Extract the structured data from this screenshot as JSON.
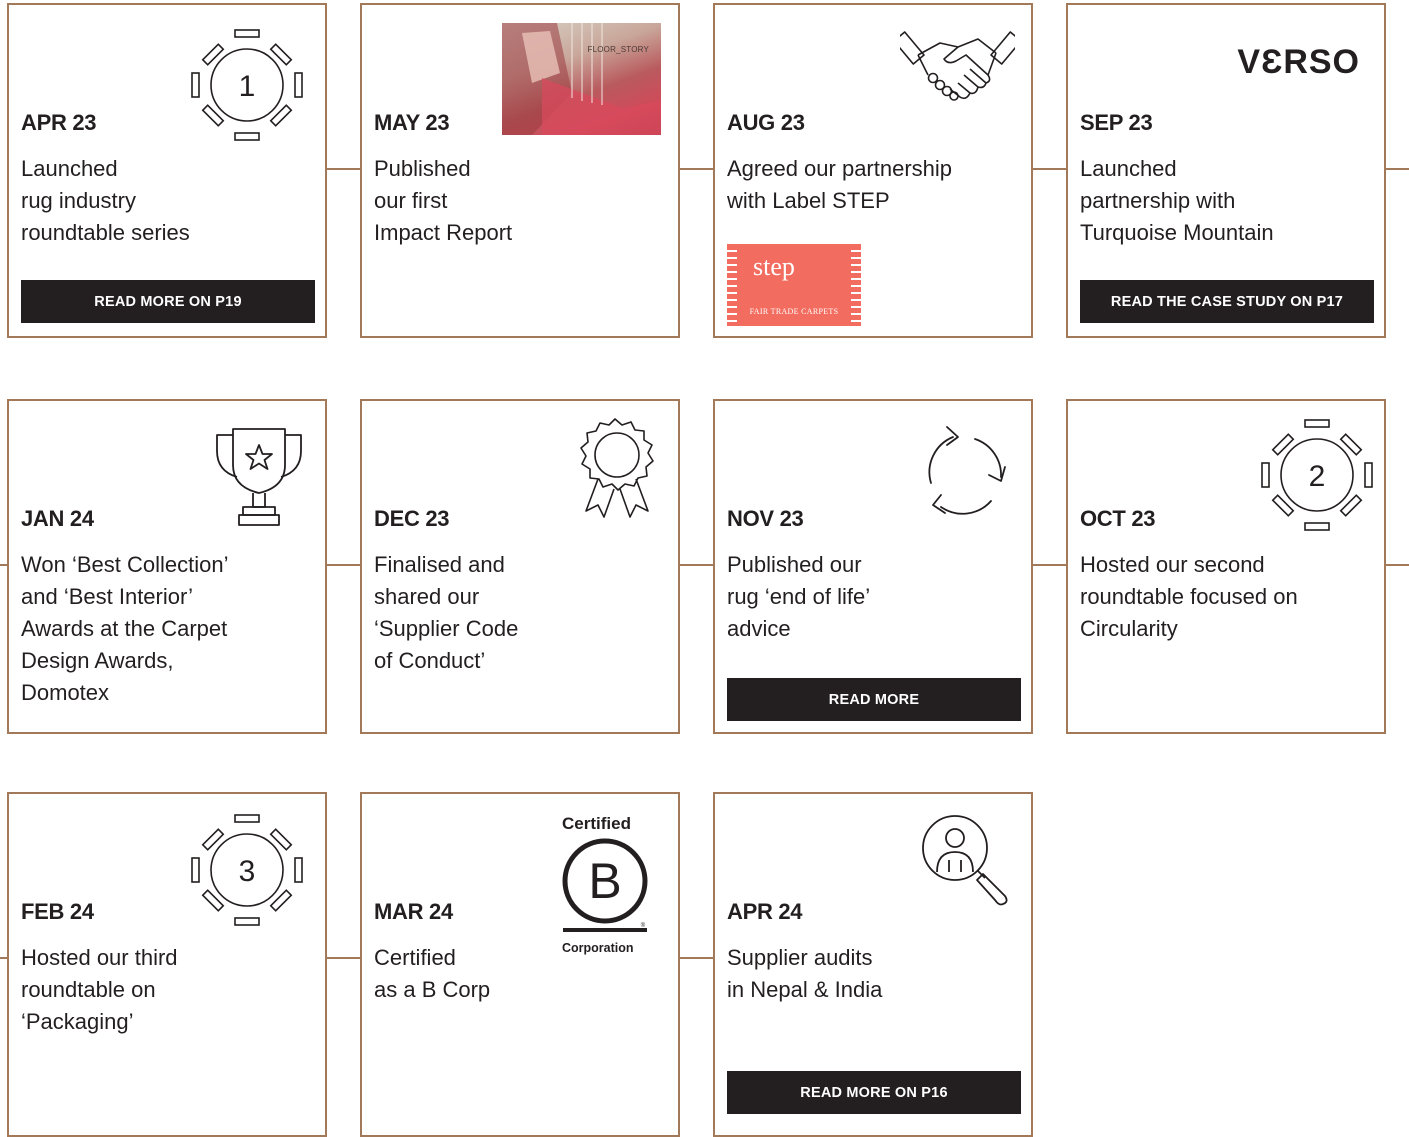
{
  "cards": {
    "apr23": {
      "date": "APR 23",
      "desc": "Launched\nrug industry\nroundtable series",
      "button": "READ MORE ON P19",
      "icon": "roundtable-icon",
      "number": "1"
    },
    "may23": {
      "date": "MAY 23",
      "desc": "Published\nour first\nImpact Report",
      "photo_brand": "FLOOR_STORY"
    },
    "aug23": {
      "date": "AUG 23",
      "desc": "Agreed our partnership\nwith Label STEP",
      "icon": "handshake-icon",
      "logo_name": "step",
      "logo_sub": "FAIR TRADE CARPETS"
    },
    "sep23": {
      "date": "SEP 23",
      "desc": "Launched\npartnership with\nTurquoise Mountain",
      "button": "READ THE CASE STUDY ON P17",
      "logo": "VƐRSO"
    },
    "jan24": {
      "date": "JAN 24",
      "desc": "Won ‘Best Collection’\nand ‘Best Interior’\nAwards at the Carpet\nDesign Awards,\nDomotex",
      "icon": "trophy-icon"
    },
    "dec23": {
      "date": "DEC 23",
      "desc": "Finalised and\nshared our\n‘Supplier Code\nof Conduct’",
      "icon": "award-rosette-icon"
    },
    "nov23": {
      "date": "NOV 23",
      "desc": "Published our\nrug ‘end of life’\nadvice",
      "button": "READ MORE",
      "icon": "recycle-icon"
    },
    "oct23": {
      "date": "OCT 23",
      "desc": "Hosted our second\nroundtable focused on\nCircularity",
      "icon": "roundtable-icon",
      "number": "2"
    },
    "feb24": {
      "date": "FEB 24",
      "desc": "Hosted our third\nroundtable on\n‘Packaging’",
      "icon": "roundtable-icon",
      "number": "3"
    },
    "mar24": {
      "date": "MAR 24",
      "desc": "Certified\nas a B Corp",
      "logo_top": "Certified",
      "logo_letter": "B",
      "logo_bottom": "Corporation",
      "logo_mark": "®"
    },
    "apr24": {
      "date": "APR 24",
      "desc": "Supplier audits\nin Nepal & India",
      "button": "READ MORE ON P16",
      "icon": "audit-search-icon"
    }
  },
  "colors": {
    "border": "#a27a5a",
    "button_bg": "#231f20",
    "step_red": "#f26c5f"
  }
}
